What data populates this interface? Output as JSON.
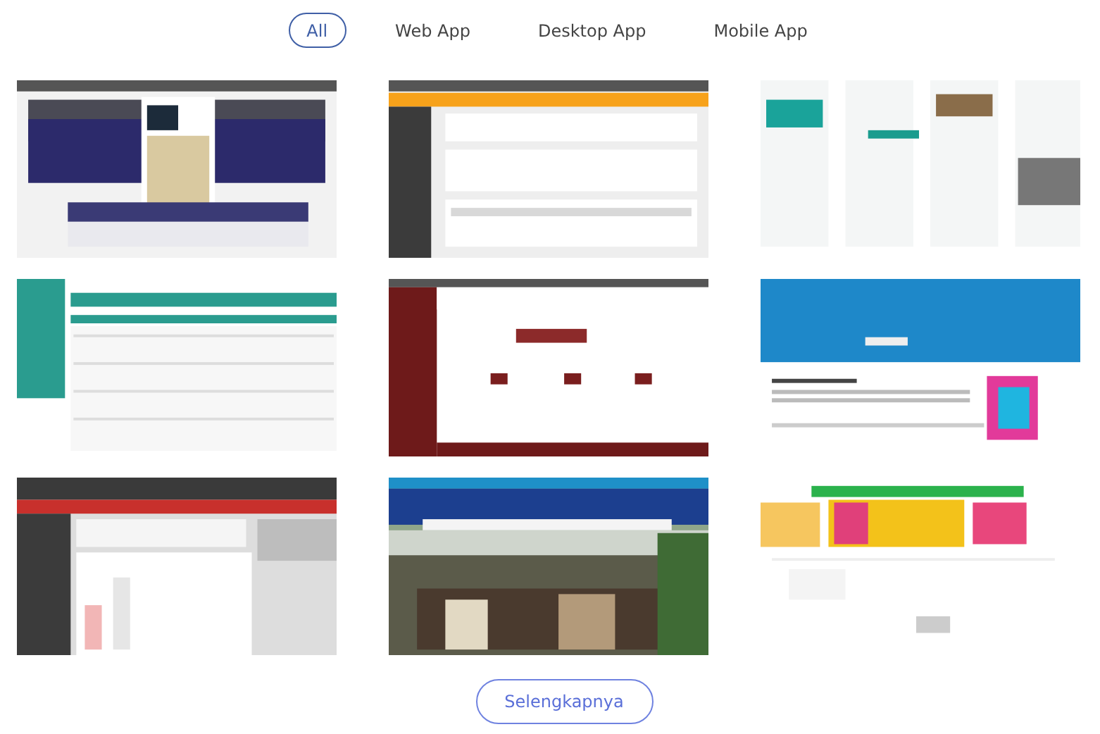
{
  "filters": [
    {
      "label": "All",
      "selected": true
    },
    {
      "label": "Web App",
      "selected": false
    },
    {
      "label": "Desktop App",
      "selected": false
    },
    {
      "label": "Mobile App",
      "selected": false
    }
  ],
  "more_button": "Selengkapnya"
}
